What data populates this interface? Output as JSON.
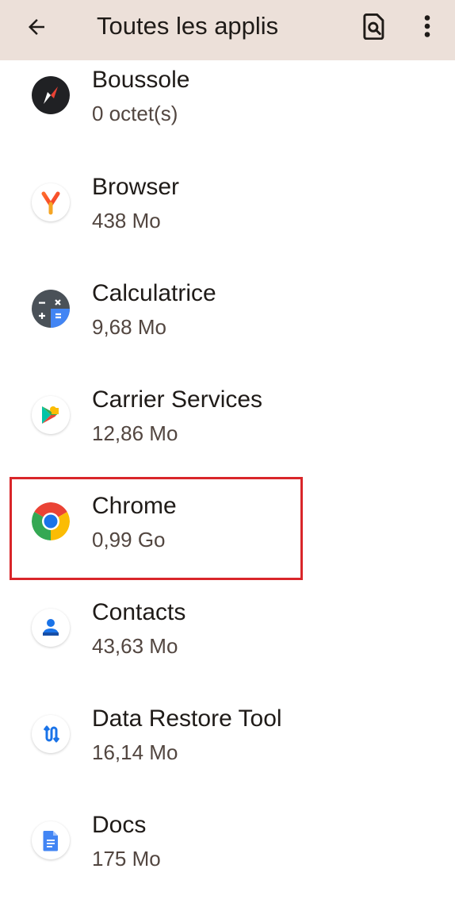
{
  "header": {
    "title": "Toutes les applis",
    "back_icon": "arrow-back-icon",
    "search_icon": "search-document-icon",
    "more_icon": "more-vert-icon",
    "background": "#ece0d9"
  },
  "apps": [
    {
      "name": "Boussole",
      "size": "0 octet(s)",
      "icon": "compass-icon"
    },
    {
      "name": "Browser",
      "size": "438 Mo",
      "icon": "yandex-browser-icon"
    },
    {
      "name": "Calculatrice",
      "size": "9,68 Mo",
      "icon": "calculator-icon"
    },
    {
      "name": "Carrier Services",
      "size": "12,86 Mo",
      "icon": "carrier-services-icon"
    },
    {
      "name": "Chrome",
      "size": "0,99 Go",
      "icon": "chrome-icon",
      "highlighted": true
    },
    {
      "name": "Contacts",
      "size": "43,63 Mo",
      "icon": "contacts-icon"
    },
    {
      "name": "Data Restore Tool",
      "size": "16,14 Mo",
      "icon": "data-restore-icon"
    },
    {
      "name": "Docs",
      "size": "175 Mo",
      "icon": "docs-icon"
    }
  ],
  "highlight_color": "#d9262a"
}
